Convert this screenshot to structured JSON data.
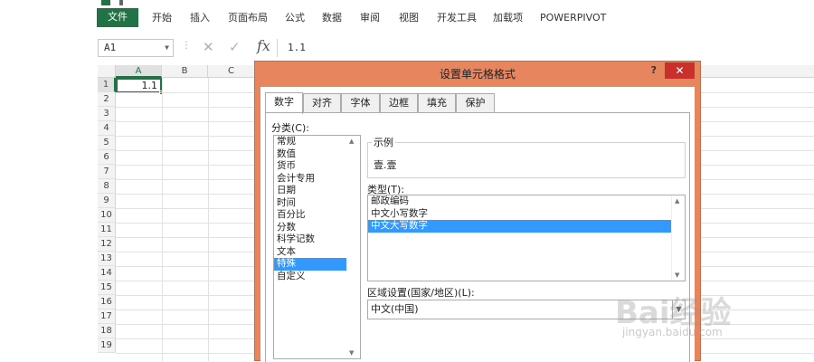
{
  "ribbon": {
    "tabs": [
      "文件",
      "开始",
      "插入",
      "页面布局",
      "公式",
      "数据",
      "审阅",
      "视图",
      "开发工具",
      "加载项",
      "POWERPIVOT"
    ]
  },
  "formula_bar": {
    "name_box": "A1",
    "fx_label": "fx",
    "cancel_glyph": "✕",
    "enter_glyph": "✓",
    "formula": "1.1"
  },
  "sheet": {
    "columns": [
      "A",
      "B",
      "C"
    ],
    "rows": [
      "1",
      "2",
      "3",
      "4",
      "5",
      "6",
      "7",
      "8",
      "9",
      "10",
      "11",
      "12",
      "13",
      "14",
      "15",
      "16",
      "17",
      "18",
      "19"
    ],
    "active_cell_value": "1.1"
  },
  "dialog": {
    "title": "设置单元格格式",
    "help_label": "?",
    "close_label": "✕",
    "tabs": [
      "数字",
      "对齐",
      "字体",
      "边框",
      "填充",
      "保护"
    ],
    "category_label": "分类(C):",
    "categories": [
      "常规",
      "数值",
      "货币",
      "会计专用",
      "日期",
      "时间",
      "百分比",
      "分数",
      "科学记数",
      "文本",
      "特殊",
      "自定义"
    ],
    "selected_category": "特殊",
    "sample_label": "示例",
    "sample_value": "壹.壹",
    "type_label": "类型(T):",
    "types": [
      "邮政编码",
      "中文小写数字",
      "中文大写数字"
    ],
    "selected_type": "中文大写数字",
    "locale_label": "区域设置(国家/地区)(L):",
    "locale_value": "中文(中国)"
  },
  "watermark": {
    "brand": "Bai经验",
    "url": "jingyan.baidu.com"
  },
  "colors": {
    "excel_green": "#217346",
    "dialog_frame": "#e6855e",
    "selection_blue": "#3399ff",
    "close_red": "#c9302c"
  }
}
